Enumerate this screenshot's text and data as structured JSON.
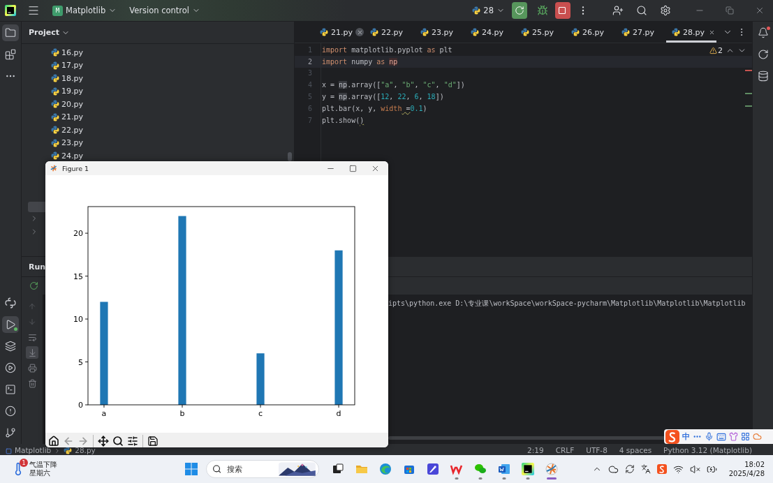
{
  "title_bar": {
    "project_initial": "M",
    "project": "Matplotlib",
    "vcs": "Version control",
    "run_config": "28"
  },
  "left_toolbar": {
    "top": [
      {
        "kind": "folder",
        "selected": true,
        "running": false
      },
      {
        "kind": "structure",
        "selected": false,
        "running": false
      },
      {
        "kind": "more",
        "selected": false,
        "running": false
      }
    ],
    "bottom": [
      {
        "kind": "python",
        "selected": false,
        "running": false
      },
      {
        "kind": "run",
        "selected": true,
        "running": true
      },
      {
        "kind": "layers",
        "selected": false,
        "running": false
      },
      {
        "kind": "services",
        "selected": false,
        "running": false
      },
      {
        "kind": "terminal",
        "selected": false,
        "running": false
      },
      {
        "kind": "problems",
        "selected": false,
        "running": false
      },
      {
        "kind": "git",
        "selected": false,
        "running": false
      }
    ]
  },
  "project_panel": {
    "title": "Project",
    "files": [
      "16.py",
      "17.py",
      "18.py",
      "19.py",
      "20.py",
      "21.py",
      "22.py",
      "23.py",
      "24.py"
    ]
  },
  "editor": {
    "tabs": [
      {
        "label": "21.py",
        "selected": false,
        "closable": true
      },
      {
        "label": "22.py",
        "selected": false,
        "closable": false
      },
      {
        "label": "23.py",
        "selected": false,
        "closable": false
      },
      {
        "label": "24.py",
        "selected": false,
        "closable": false
      },
      {
        "label": "25.py",
        "selected": false,
        "closable": false
      },
      {
        "label": "26.py",
        "selected": false,
        "closable": false
      },
      {
        "label": "27.py",
        "selected": false,
        "closable": false
      },
      {
        "label": "28.py",
        "selected": true,
        "closable": true
      }
    ],
    "warnings": "2",
    "lines": [
      {
        "number": "1",
        "current": false,
        "tokens": [
          {
            "text": "import",
            "kind": "keyword"
          },
          {
            "text": " matplotlib.pyplot ",
            "kind": "plain"
          },
          {
            "text": "as",
            "kind": "keyword"
          },
          {
            "text": " plt",
            "kind": "plain"
          }
        ]
      },
      {
        "number": "2",
        "current": true,
        "tokens": [
          {
            "text": "import",
            "kind": "keyword"
          },
          {
            "text": " numpy ",
            "kind": "plain"
          },
          {
            "text": "as ",
            "kind": "keyword"
          },
          {
            "text": "np",
            "kind": "alias"
          }
        ]
      },
      {
        "number": "3",
        "current": false
      },
      {
        "number": "4",
        "current": false,
        "tokens": [
          {
            "text": "x = ",
            "kind": "plain"
          },
          {
            "text": "np",
            "kind": "ref"
          },
          {
            "text": ".array([",
            "kind": "plain"
          },
          {
            "text": "\"a\"",
            "kind": "string"
          },
          {
            "text": ", ",
            "kind": "plain"
          },
          {
            "text": "\"b\"",
            "kind": "string"
          },
          {
            "text": ", ",
            "kind": "plain"
          },
          {
            "text": "\"c\"",
            "kind": "string"
          },
          {
            "text": ", ",
            "kind": "plain"
          },
          {
            "text": "\"d\"",
            "kind": "string"
          },
          {
            "text": "])",
            "kind": "plain"
          }
        ]
      },
      {
        "number": "5",
        "current": false,
        "tokens": [
          {
            "text": "y = ",
            "kind": "plain"
          },
          {
            "text": "np",
            "kind": "ref"
          },
          {
            "text": ".array([",
            "kind": "plain"
          },
          {
            "text": "12",
            "kind": "number"
          },
          {
            "text": ", ",
            "kind": "plain"
          },
          {
            "text": "22",
            "kind": "number"
          },
          {
            "text": ", ",
            "kind": "plain"
          },
          {
            "text": "6",
            "kind": "number"
          },
          {
            "text": ", ",
            "kind": "plain"
          },
          {
            "text": "18",
            "kind": "number"
          },
          {
            "text": "])",
            "kind": "plain"
          }
        ]
      },
      {
        "number": "6",
        "current": false,
        "tokens": [
          {
            "text": "plt.bar(x, y, ",
            "kind": "plain"
          },
          {
            "text": "width",
            "kind": "param"
          },
          {
            "text": " =",
            "kind": "warn"
          },
          {
            "text": "0.1",
            "kind": "number"
          },
          {
            "text": ")",
            "kind": "plain"
          }
        ]
      },
      {
        "number": "7",
        "current": false,
        "tokens": [
          {
            "text": "plt.show(",
            "kind": "plain"
          },
          {
            "text": ")",
            "kind": "warn"
          }
        ]
      }
    ]
  },
  "right_toolbar": [
    {
      "kind": "bell",
      "unread": true
    },
    {
      "kind": "ai",
      "unread": false
    },
    {
      "kind": "database",
      "unread": false
    }
  ],
  "run_panel": {
    "title": "Run",
    "console": "ipts\\python.exe D:\\专业课\\workSpace\\workSpace-pycharm\\Matplotlib\\Matplotlib\\Matplotlib"
  },
  "status_bar": {
    "project": "Matplotlib",
    "file": "28.py",
    "items": [
      "2:19",
      "CRLF",
      "UTF-8",
      "4 spaces",
      "Python 3.12 (Matplotlib)"
    ]
  },
  "ime_bar": {
    "mode": "中"
  },
  "figure": {
    "title": "Figure 1",
    "chart_data": {
      "type": "bar",
      "categories": [
        "a",
        "b",
        "c",
        "d"
      ],
      "values": [
        12,
        22,
        6,
        18
      ],
      "ylim": [
        0,
        23.1
      ],
      "yticks": [
        0,
        5,
        10,
        15,
        20
      ]
    },
    "tools": [
      {
        "kind": "home",
        "disabled": false
      },
      {
        "kind": "back",
        "disabled": true
      },
      {
        "kind": "forward",
        "disabled": true
      },
      {
        "kind": "pan",
        "disabled": false
      },
      {
        "kind": "zoom",
        "disabled": false
      },
      {
        "kind": "configure",
        "disabled": false
      },
      {
        "kind": "save",
        "disabled": false
      }
    ]
  },
  "taskbar": {
    "weather": {
      "badge": "1",
      "title": "气温下降",
      "subtitle": "星期六"
    },
    "search_placeholder": "搜索",
    "apps": [
      {
        "kind": "taskview",
        "running": false,
        "active": false
      },
      {
        "kind": "explorer",
        "running": false,
        "active": false
      },
      {
        "kind": "edge",
        "running": false,
        "active": false
      },
      {
        "kind": "store",
        "running": false,
        "active": false
      },
      {
        "kind": "pen",
        "running": false,
        "active": false
      },
      {
        "kind": "wps",
        "running": true,
        "active": false
      },
      {
        "kind": "wechat",
        "running": true,
        "active": false
      },
      {
        "kind": "word",
        "running": true,
        "active": false
      },
      {
        "kind": "pycharm",
        "running": true,
        "active": false
      },
      {
        "kind": "figure",
        "running": true,
        "active": true
      }
    ],
    "time": "18:02",
    "date": "2025/4/28"
  }
}
